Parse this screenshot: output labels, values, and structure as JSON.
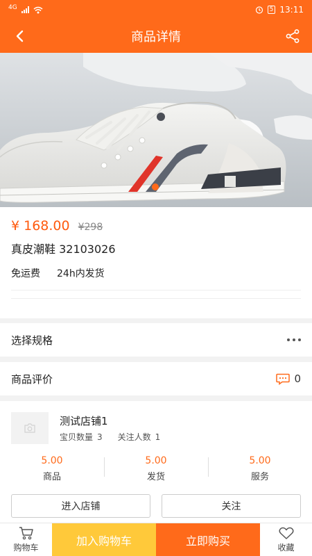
{
  "status_bar": {
    "signal_label": "4G",
    "battery": "5",
    "time": "13:11"
  },
  "nav": {
    "title": "商品详情",
    "back_icon": "arrow-left-icon",
    "share_icon": "share-icon"
  },
  "product": {
    "price": "¥ 168.00",
    "original_price": "¥298",
    "name": "真皮潮鞋 32103026",
    "tags": [
      "免运费",
      "24h内发货"
    ]
  },
  "spec": {
    "label": "选择规格"
  },
  "review": {
    "label": "商品评价",
    "count": "0"
  },
  "shop": {
    "name": "测试店铺1",
    "goods_count_label": "宝贝数量",
    "goods_count": "3",
    "followers_label": "关注人数",
    "followers": "1",
    "scores": [
      {
        "value": "5.00",
        "label": "商品"
      },
      {
        "value": "5.00",
        "label": "发货"
      },
      {
        "value": "5.00",
        "label": "服务"
      }
    ],
    "enter_button": "进入店铺",
    "follow_button": "关注"
  },
  "bottom_bar": {
    "cart_label": "购物车",
    "add_to_cart": "加入购物车",
    "buy_now": "立即购买",
    "favorite_label": "收藏"
  },
  "colors": {
    "accent": "#ff6a1a",
    "cart_button": "#ffc93a",
    "price": "#ff5a0e"
  }
}
